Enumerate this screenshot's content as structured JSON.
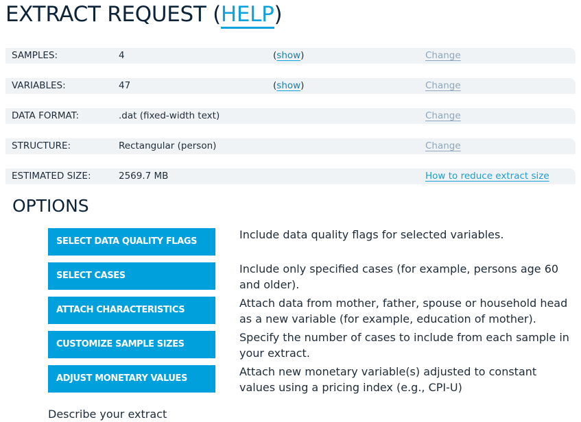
{
  "header": {
    "title": "EXTRACT REQUEST",
    "paren_open": " (",
    "help_label": "HELP",
    "paren_close": ")"
  },
  "summary": {
    "samples": {
      "label": "SAMPLES:",
      "value": "4",
      "show_label": "show",
      "change_label": "Change"
    },
    "variables": {
      "label": "VARIABLES:",
      "value": "47",
      "show_label": "show",
      "change_label": "Change"
    },
    "data_format": {
      "label": "DATA FORMAT:",
      "value": ".dat (fixed-width text)",
      "change_label": "Change"
    },
    "structure": {
      "label": "STRUCTURE:",
      "value": "Rectangular (person)",
      "change_label": "Change"
    },
    "estimated_size": {
      "label": "ESTIMATED SIZE:",
      "value": "2569.7 MB",
      "reduce_label": "How to reduce extract size"
    },
    "paren_open": "(",
    "paren_close": ")"
  },
  "options": {
    "title": "OPTIONS",
    "items": [
      {
        "button_label": "SELECT DATA QUALITY FLAGS",
        "description": "Include data quality flags for selected variables."
      },
      {
        "button_label": "SELECT CASES",
        "description": "Include only specified cases (for example, persons age 60 and older)."
      },
      {
        "button_label": "ATTACH CHARACTERISTICS",
        "description": "Attach data from mother, father, spouse or household head as a new variable (for example, education of mother)."
      },
      {
        "button_label": "CUSTOMIZE SAMPLE SIZES",
        "description": "Specify the number of cases to include from each sample in your extract."
      },
      {
        "button_label": "ADJUST MONETARY VALUES",
        "description": "Attach new monetary variable(s) adjusted to constant values using a pricing index (e.g., CPI-U)"
      }
    ]
  },
  "describe": {
    "label": "Describe your extract"
  },
  "colors": {
    "accent": "#00a0dc",
    "link": "#0ea2dc",
    "muted_link": "#8fa6bb",
    "row_background": "#eff3f6",
    "heading": "#0c2338"
  }
}
